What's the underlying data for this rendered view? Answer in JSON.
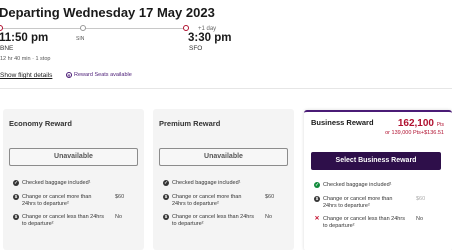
{
  "header": {
    "title": "Departing Wednesday 17 May 2023"
  },
  "route": {
    "departure_time": "11:50 pm",
    "departure_airport": "BNE",
    "stop_code": "SIN",
    "plus_day": "+1 day",
    "arrival_time": "3:30 pm",
    "arrival_airport": "SFO",
    "duration_stops": "12 hr 40 min · 1 stop",
    "show_details_label": "Show flight details",
    "reward_seats_label": "Reward Seats available"
  },
  "cards": {
    "economy": {
      "title": "Economy Reward",
      "button": "Unavailable",
      "rows": [
        {
          "text": "Checked baggage included¹",
          "value": ""
        },
        {
          "text": "Change or cancel more than 24hrs to departure²",
          "value": "$60"
        },
        {
          "text": "Change or cancel less than 24hrs to departure²",
          "value": "No"
        }
      ]
    },
    "premium": {
      "title": "Premium Reward",
      "button": "Unavailable",
      "rows": [
        {
          "text": "Checked baggage included¹",
          "value": ""
        },
        {
          "text": "Change or cancel more than 24hrs to departure²",
          "value": "$60"
        },
        {
          "text": "Change or cancel less than 24hrs to departure²",
          "value": "No"
        }
      ]
    },
    "business": {
      "title": "Business Reward",
      "points": "162,100",
      "points_unit": "Pts",
      "alt_price": "or 139,000 Pts+$136.51",
      "button": "Select Business Reward",
      "rows": [
        {
          "text": "Checked baggage included¹",
          "value": ""
        },
        {
          "text": "Change or cancel more than 24hrs to departure²",
          "value": "$60"
        },
        {
          "text": "Change or cancel less than 24hrs to departure²",
          "value": "No"
        }
      ]
    }
  },
  "colors": {
    "accent": "#4a1b76",
    "brand_red": "#b0102f",
    "button_dark": "#2e0f4a"
  }
}
